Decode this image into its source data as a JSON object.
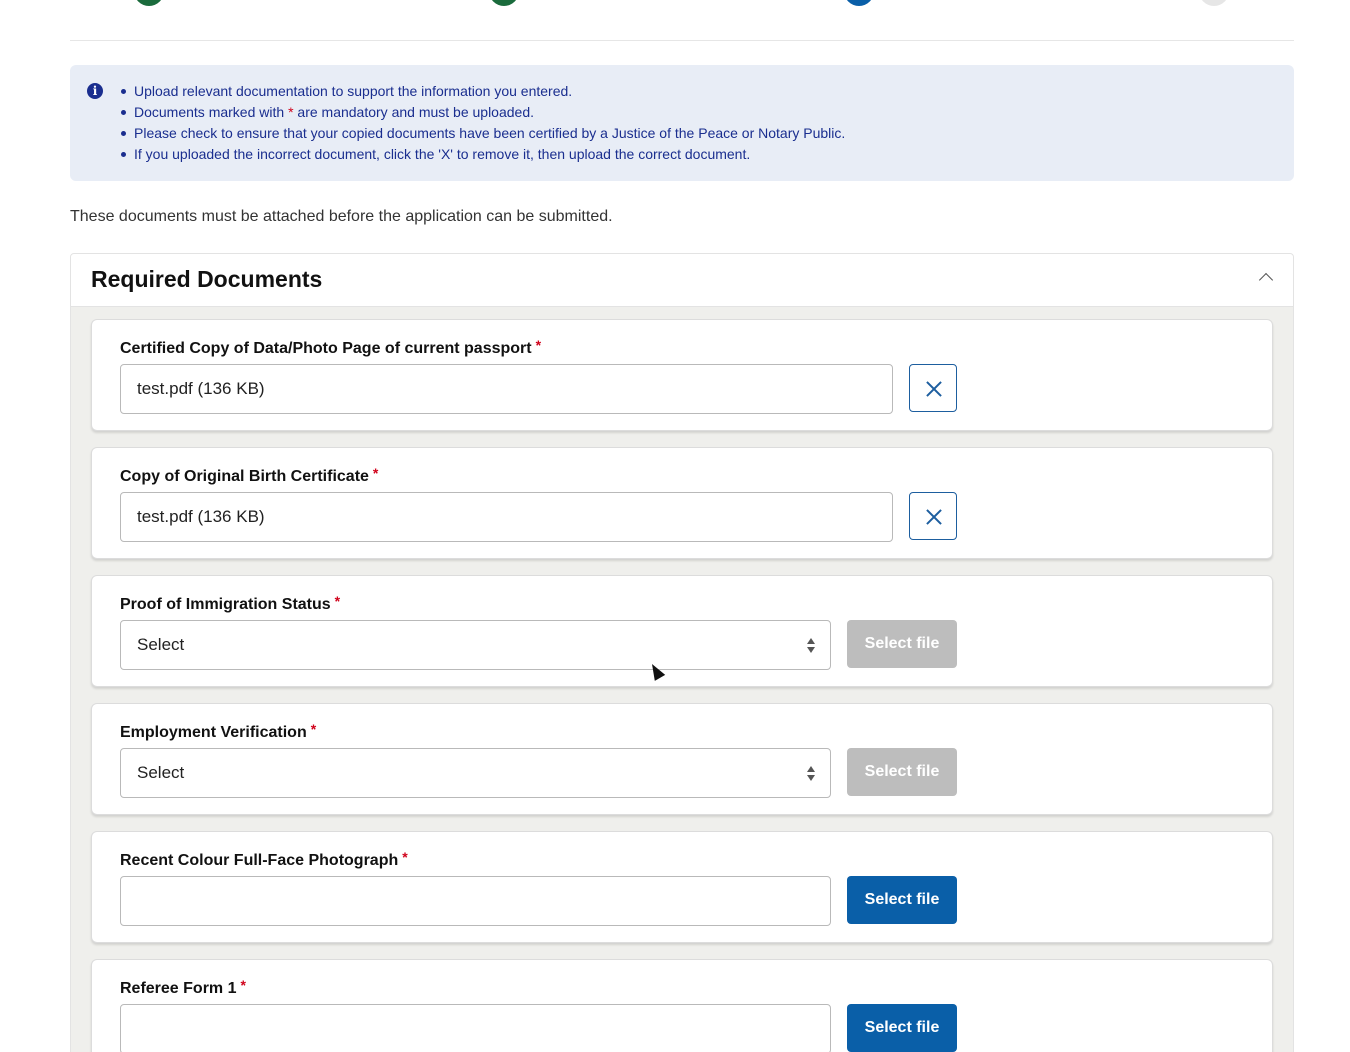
{
  "progress": {
    "steps": [
      {
        "status": "complete",
        "color": "#1a6b3c"
      },
      {
        "status": "complete",
        "color": "#1a6b3c"
      },
      {
        "status": "current",
        "color": "#0a5fa8"
      },
      {
        "status": "upcoming",
        "color": "#e6e6e6"
      }
    ]
  },
  "info": {
    "icon": "info-icon",
    "items": [
      "Upload relevant documentation to support the information you entered.",
      "Documents marked with",
      "are mandatory and must be uploaded.",
      "Please check to ensure that your copied documents have been certified by a Justice of the Peace or Notary Public.",
      "If you uploaded the incorrect document, click the 'X' to remove it, then upload the correct document."
    ],
    "required_marker": "*"
  },
  "intro_text": "These documents must be attached before the application can be submitted.",
  "panel": {
    "title": "Required Documents",
    "collapse_icon": "chevron-up-icon"
  },
  "documents": [
    {
      "label": "Certified Copy of Data/Photo Page of current passport",
      "required": "*",
      "value": "test.pdf (136 KB)",
      "state": "uploaded"
    },
    {
      "label": "Copy of Original Birth Certificate",
      "required": "*",
      "value": "test.pdf (136 KB)",
      "state": "uploaded"
    },
    {
      "label": "Proof of Immigration Status",
      "required": "*",
      "value": "Select",
      "state": "select",
      "button": "Select file"
    },
    {
      "label": "Employment Verification",
      "required": "*",
      "value": "Select",
      "state": "select",
      "button": "Select file"
    },
    {
      "label": "Recent Colour Full-Face Photograph",
      "required": "*",
      "value": "",
      "state": "empty",
      "button": "Select file"
    },
    {
      "label": "Referee Form 1",
      "required": "*",
      "value": "",
      "state": "empty",
      "button": "Select file"
    }
  ],
  "colors": {
    "info_bg": "#e8edf6",
    "info_text": "#1a2e8f",
    "required": "#d0021b",
    "primary_button": "#0a5fa8",
    "disabled_button": "#bdbdbd"
  }
}
